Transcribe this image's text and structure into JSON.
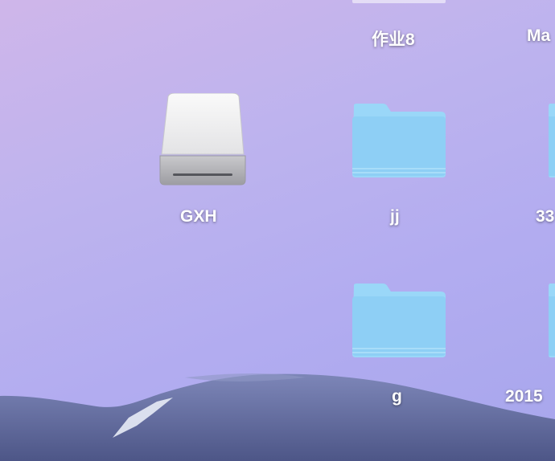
{
  "desktop": {
    "items": [
      {
        "label": "作业8",
        "type": "partial-top"
      },
      {
        "label": "Ma",
        "type": "partial-top"
      },
      {
        "label": "GXH",
        "type": "drive-icon"
      },
      {
        "label": "jj",
        "type": "folder-icon"
      },
      {
        "label": "33",
        "type": "folder-icon"
      },
      {
        "label": "g",
        "type": "folder-icon"
      },
      {
        "label": "2015",
        "type": "folder-icon"
      }
    ]
  },
  "colors": {
    "folder": "#8ecff5",
    "folder_tab": "#9ad7f8",
    "wallpaper_top": "#cfb6ea",
    "wallpaper_bottom": "#a7a6ec"
  }
}
